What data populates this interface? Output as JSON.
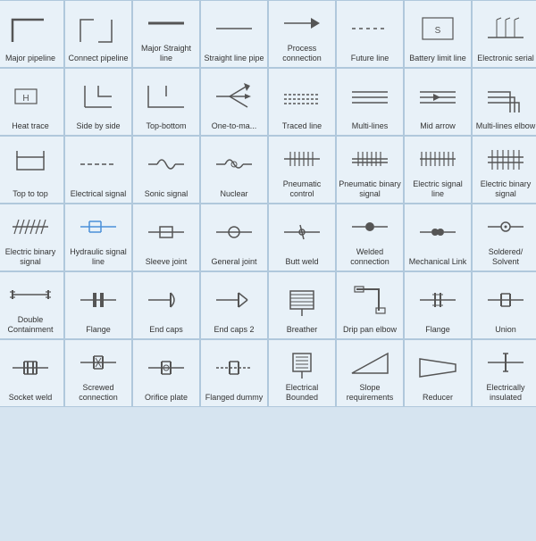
{
  "cells": [
    {
      "label": "Major pipeline",
      "symbol": "major_pipeline"
    },
    {
      "label": "Connect pipeline",
      "symbol": "connect_pipeline"
    },
    {
      "label": "Major Straight line",
      "symbol": "major_straight"
    },
    {
      "label": "Straight line pipe",
      "symbol": "straight_line_pipe"
    },
    {
      "label": "Process connection",
      "symbol": "process_connection"
    },
    {
      "label": "Future line",
      "symbol": "future_line"
    },
    {
      "label": "Battery limit line",
      "symbol": "battery_limit"
    },
    {
      "label": "Electronic serial",
      "symbol": "electronic_serial"
    },
    {
      "label": "Heat trace",
      "symbol": "heat_trace"
    },
    {
      "label": "Side by side",
      "symbol": "side_by_side"
    },
    {
      "label": "Top-bottom",
      "symbol": "top_bottom"
    },
    {
      "label": "One-to-ma...",
      "symbol": "one_to_many"
    },
    {
      "label": "Traced line",
      "symbol": "traced_line"
    },
    {
      "label": "Multi-lines",
      "symbol": "multi_lines"
    },
    {
      "label": "Mid arrow",
      "symbol": "mid_arrow"
    },
    {
      "label": "Multi-lines elbow",
      "symbol": "multi_lines_elbow"
    },
    {
      "label": "Top to top",
      "symbol": "top_to_top"
    },
    {
      "label": "Electrical signal",
      "symbol": "electrical_signal"
    },
    {
      "label": "Sonic signal",
      "symbol": "sonic_signal"
    },
    {
      "label": "Nuclear",
      "symbol": "nuclear"
    },
    {
      "label": "Pneumatic control",
      "symbol": "pneumatic_control"
    },
    {
      "label": "Pneumatic binary signal",
      "symbol": "pneumatic_binary"
    },
    {
      "label": "Electric signal line",
      "symbol": "electric_signal_line"
    },
    {
      "label": "Electric binary signal",
      "symbol": "electric_binary_signal"
    },
    {
      "label": "Electric binary signal",
      "symbol": "electric_binary_signal2"
    },
    {
      "label": "Hydraulic signal line",
      "symbol": "hydraulic_signal"
    },
    {
      "label": "Sleeve joint",
      "symbol": "sleeve_joint"
    },
    {
      "label": "General joint",
      "symbol": "general_joint"
    },
    {
      "label": "Butt weld",
      "symbol": "butt_weld"
    },
    {
      "label": "Welded connection",
      "symbol": "welded_connection"
    },
    {
      "label": "Mechanical Link",
      "symbol": "mechanical_link"
    },
    {
      "label": "Soldered/ Solvent",
      "symbol": "soldered"
    },
    {
      "label": "Double Containment",
      "symbol": "double_containment"
    },
    {
      "label": "Flange",
      "symbol": "flange"
    },
    {
      "label": "End caps",
      "symbol": "end_caps"
    },
    {
      "label": "End caps 2",
      "symbol": "end_caps2"
    },
    {
      "label": "Breather",
      "symbol": "breather"
    },
    {
      "label": "Drip pan elbow",
      "symbol": "drip_pan"
    },
    {
      "label": "Flange",
      "symbol": "flange2"
    },
    {
      "label": "Union",
      "symbol": "union"
    },
    {
      "label": "Socket weld",
      "symbol": "socket_weld"
    },
    {
      "label": "Screwed connection",
      "symbol": "screwed"
    },
    {
      "label": "Orifice plate",
      "symbol": "orifice_plate"
    },
    {
      "label": "Flanged dummy",
      "symbol": "flanged_dummy"
    },
    {
      "label": "Electrical Bounded",
      "symbol": "electrical_bounded"
    },
    {
      "label": "Slope requirements",
      "symbol": "slope"
    },
    {
      "label": "Reducer",
      "symbol": "reducer"
    },
    {
      "label": "Electrically insulated",
      "symbol": "electrically_insulated"
    }
  ]
}
